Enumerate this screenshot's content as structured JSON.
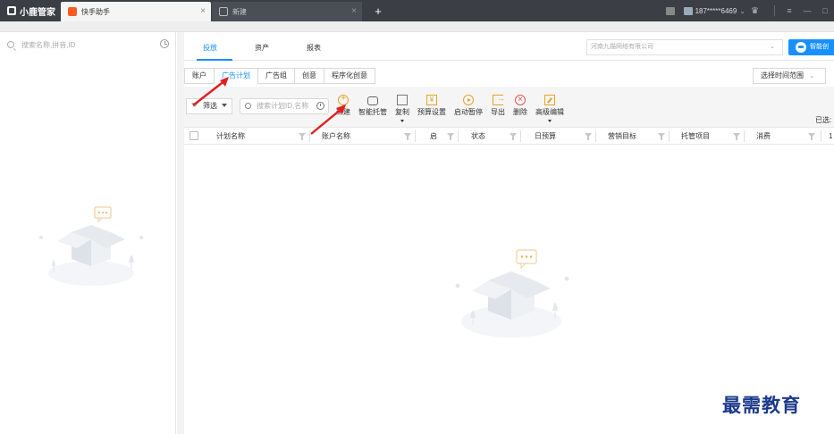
{
  "titlebar": {
    "brand": "小鹿管家",
    "tabs": [
      {
        "label": "快手助手",
        "active": true
      },
      {
        "label": "新建",
        "active": false
      }
    ],
    "phone": "187*****6469",
    "phone_caret": "⌄"
  },
  "left": {
    "search_placeholder": "搜索名称,拼音,ID"
  },
  "topnav": {
    "tabs": [
      "投放",
      "资产",
      "报表"
    ],
    "active": "投放",
    "company": "河南九描网络有限公司",
    "smart_button": "智能创"
  },
  "subtabs": {
    "items": [
      "账户",
      "广告计划",
      "广告组",
      "创意",
      "程序化创意"
    ],
    "active": "广告计划",
    "time_range": "选择时间范围"
  },
  "toolbar": {
    "filter_label": "筛选",
    "search_placeholder": "搜索计划ID,名称",
    "actions": [
      {
        "label": "新建",
        "icon": "add-circle-icon"
      },
      {
        "label": "智能托管",
        "icon": "robot-icon"
      },
      {
        "label": "复制",
        "icon": "copy-icon"
      },
      {
        "label": "预算设置",
        "icon": "yen-icon"
      },
      {
        "label": "启动暂停",
        "icon": "play-pause-icon"
      },
      {
        "label": "导出",
        "icon": "export-icon"
      },
      {
        "label": "删除",
        "icon": "delete-icon"
      },
      {
        "label": "高级编辑",
        "icon": "edit-icon"
      }
    ],
    "selected_text": "已选:"
  },
  "table": {
    "columns": [
      "计划名称",
      "账户名称",
      "启",
      "状态",
      "日预算",
      "营销目标",
      "托管项目",
      "消费",
      "1"
    ]
  },
  "watermark": "最需教育",
  "colors": {
    "accent": "#1890ff",
    "titlebar": "#3b3f45",
    "brand_tab_icon": "#ff5a1f",
    "arrow": "#e02020"
  }
}
